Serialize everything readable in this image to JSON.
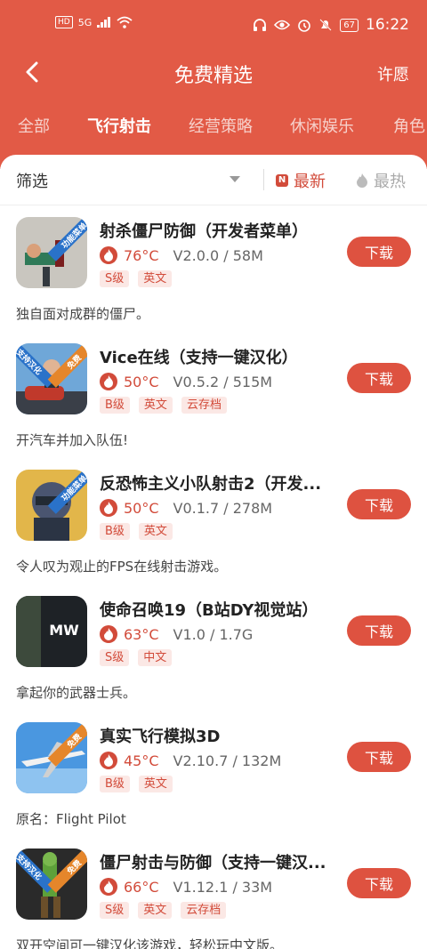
{
  "status": {
    "time": "16:22",
    "battery": "67",
    "network": "5G",
    "hd": "HD"
  },
  "header": {
    "title": "免费精选",
    "wish": "许愿"
  },
  "tabs": [
    {
      "label": "全部"
    },
    {
      "label": "飞行射击"
    },
    {
      "label": "经营策略"
    },
    {
      "label": "休闲娱乐"
    },
    {
      "label": "角色"
    }
  ],
  "filter": {
    "label": "筛选",
    "sort_new": "最新",
    "sort_hot": "最热"
  },
  "colors": {
    "accent": "#e25a46",
    "tag_bg": "#fbe8e5"
  },
  "games": [
    {
      "name": "射杀僵尸防御（开发者菜单）",
      "temp": "76°C",
      "version": "V2.0.0 / 58M",
      "tags": [
        "S级",
        "英文"
      ],
      "desc": "独自面对成群的僵尸。",
      "ribbon": "功能菜单",
      "download": "下载"
    },
    {
      "name": "Vice在线（支持一键汉化）",
      "temp": "50°C",
      "version": "V0.5.2 / 515M",
      "tags": [
        "B级",
        "英文",
        "云存档"
      ],
      "desc": "开汽车并加入队伍!",
      "ribbon": "免费",
      "download": "下载"
    },
    {
      "name": "反恐怖主义小队射击2（开发...",
      "temp": "50°C",
      "version": "V0.1.7 / 278M",
      "tags": [
        "B级",
        "英文"
      ],
      "desc": "令人叹为观止的FPS在线射击游戏。",
      "ribbon": "功能菜单",
      "download": "下载"
    },
    {
      "name": "使命召唤19（B站DY视觉站）",
      "temp": "63°C",
      "version": "V1.0 / 1.7G",
      "tags": [
        "S级",
        "中文"
      ],
      "desc": "拿起你的武器士兵。",
      "ribbon": "",
      "download": "下载"
    },
    {
      "name": "真实飞行模拟3D",
      "temp": "45°C",
      "version": "V2.10.7 / 132M",
      "tags": [
        "B级",
        "英文"
      ],
      "desc": "原名：Flight Pilot",
      "ribbon": "免费",
      "download": "下载"
    },
    {
      "name": "僵尸射击与防御（支持一键汉...",
      "temp": "66°C",
      "version": "V1.12.1 / 33M",
      "tags": [
        "S级",
        "英文",
        "云存档"
      ],
      "desc": "双开空间可一键汉化该游戏，轻松玩中文版。",
      "ribbon": "免费",
      "download": "下载"
    }
  ]
}
